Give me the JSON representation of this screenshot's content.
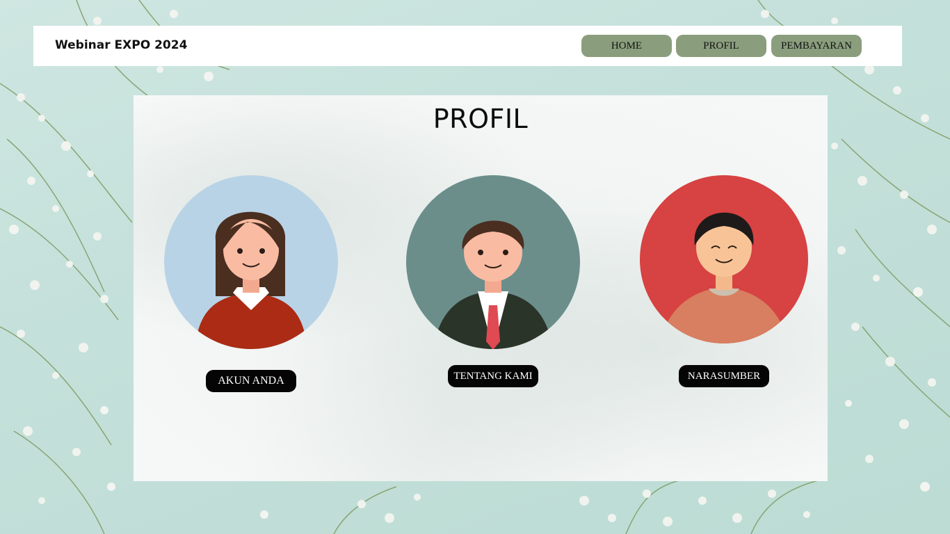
{
  "header": {
    "brand": "Webinar EXPO 2024",
    "nav": [
      {
        "label": "HOME"
      },
      {
        "label": "PROFIL"
      },
      {
        "label": "PEMBAYARAN"
      }
    ]
  },
  "main": {
    "title": "PROFIL",
    "profiles": [
      {
        "label": "AKUN ANDA",
        "circle_color": "#b9d3e6",
        "icon": "woman-avatar-icon"
      },
      {
        "label": "TENTANG KAMI",
        "circle_color": "#6b8e8b",
        "icon": "businessman-avatar-icon"
      },
      {
        "label": "NARASUMBER",
        "circle_color": "#d74242",
        "icon": "man-avatar-icon"
      }
    ]
  },
  "colors": {
    "nav_button": "#8a9e7d",
    "pill": "#050505",
    "background": "#c4e0da"
  }
}
